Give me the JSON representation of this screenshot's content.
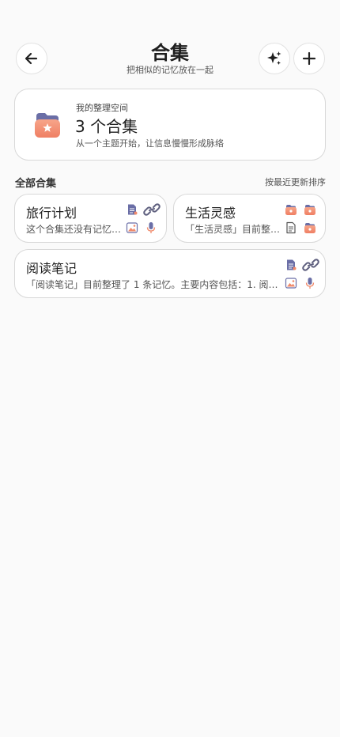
{
  "header": {
    "title": "合集",
    "subtitle": "把相似的记忆放在一起"
  },
  "workspace": {
    "label": "我的整理空间",
    "count": "3 个合集",
    "description": "从一个主题开始，让信息慢慢形成脉络"
  },
  "section": {
    "title": "全部合集",
    "sort_label": "按最近更新排序"
  },
  "collections": [
    {
      "name": "旅行计划",
      "description": "这个合集还没有记忆…",
      "icons": [
        "document-icon",
        "link-icon",
        "image-icon",
        "mic-icon"
      ]
    },
    {
      "name": "生活灵感",
      "description": "「生活灵感」目前整…",
      "icons": [
        "folder-icon",
        "folder-icon",
        "text-icon",
        "folder-icon"
      ]
    },
    {
      "name": "阅读笔记",
      "description": "「阅读笔记」目前整理了 1 条记忆。主要内容包括：1. 阅…",
      "icons": [
        "document-icon",
        "link-icon",
        "image-icon",
        "mic-icon"
      ]
    }
  ],
  "colors": {
    "accent_purple": "#6b6fa8",
    "accent_orange": "#f08a6b"
  }
}
